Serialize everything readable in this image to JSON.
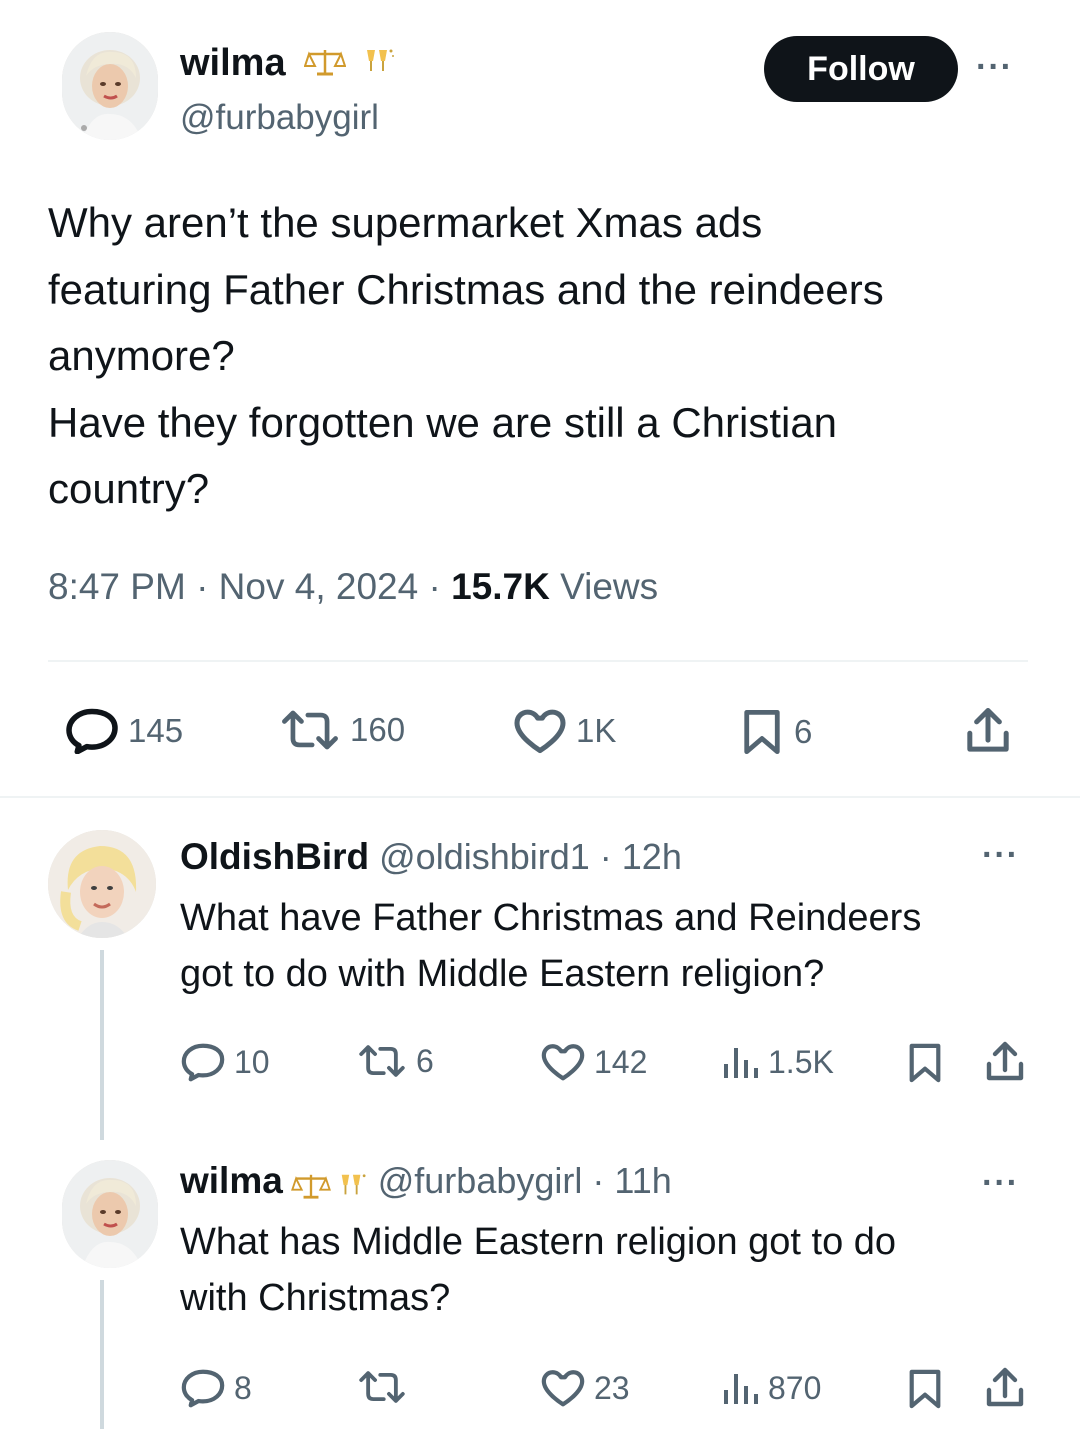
{
  "main_post": {
    "display_name": "wilma",
    "badge_icons": [
      "scales-icon",
      "champagne-icon"
    ],
    "handle": "@furbabygirl",
    "follow_label": "Follow",
    "more_label": "···",
    "text_lines": [
      "Why aren’t the supermarket Xmas ads",
      "featuring Father Christmas and the reindeers",
      "anymore?",
      "Have they forgotten we are still a Christian",
      "country?"
    ],
    "time": "8:47 PM · Nov 4, 2024 · ",
    "views_count": "15.7K",
    "views_label": " Views",
    "actions": {
      "replies": "145",
      "reposts": "160",
      "likes": "1K",
      "bookmarks": "6"
    }
  },
  "replies": [
    {
      "display_name": "OldishBird",
      "handle_time": " @oldishbird1 · 12h",
      "more_label": "···",
      "text_lines": [
        "What have Father Christmas and Reindeers",
        "got to do with Middle Eastern religion?"
      ],
      "actions": {
        "replies": "10",
        "reposts": "6",
        "likes": "142",
        "views": "1.5K"
      }
    },
    {
      "display_name": "wilma",
      "badge_icons": [
        "scales-icon",
        "champagne-icon"
      ],
      "handle_time": " @furbabygirl · 11h",
      "more_label": "···",
      "text_lines": [
        "What has Middle Eastern religion got to do",
        "with Christmas?"
      ],
      "actions": {
        "replies": "8",
        "reposts": "",
        "likes": "23",
        "views": "870"
      }
    }
  ],
  "colors": {
    "text": "#0f1419",
    "muted": "#536471",
    "follow_bg": "#0f1419",
    "divider": "#eff3f4",
    "thread_line": "#cfd9de"
  }
}
